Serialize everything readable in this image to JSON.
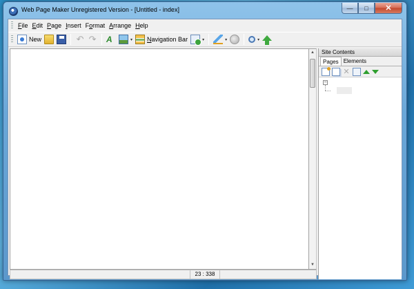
{
  "window": {
    "title": "Web Page Maker Unregistered Version - [Untitled - index]",
    "controls": {
      "minimize": "—",
      "maximize": "□",
      "close": "✕"
    }
  },
  "menubar": {
    "items": [
      {
        "label": "File",
        "accel": "F",
        "rest": "ile"
      },
      {
        "label": "Edit",
        "accel": "E",
        "rest": "dit"
      },
      {
        "label": "Page",
        "accel": "P",
        "rest": "age"
      },
      {
        "label": "Insert",
        "accel": "I",
        "rest": "nsert"
      },
      {
        "label": "Format",
        "pre": "F",
        "accel": "o",
        "rest": "rmat"
      },
      {
        "label": "Arrange",
        "accel": "A",
        "rest": "rrange"
      },
      {
        "label": "Help",
        "accel": "H",
        "rest": "elp"
      }
    ]
  },
  "toolbar": {
    "new_label": "New",
    "navbar_label": "Navigation Bar",
    "navbar_accel": "N",
    "navbar_rest": "avigation Bar",
    "icons": [
      "new-page-icon",
      "open-folder-icon",
      "save-disk-icon",
      "undo-icon",
      "redo-icon",
      "text-icon",
      "image-icon",
      "navigation-bar-icon",
      "form-icon",
      "pencil-icon",
      "publish-icon",
      "zoom-icon",
      "upload-icon"
    ],
    "drop_glyph": "▾"
  },
  "status": {
    "position": "23 : 338"
  },
  "panel": {
    "title": "Site Contents",
    "tabs": [
      "Pages",
      "Elements"
    ],
    "active_tab": "Pages",
    "tree_expander": "−"
  },
  "glyphs": {
    "undo": "↶",
    "redo": "↷",
    "delete": "✕",
    "text": "A",
    "scroll_up": "▲",
    "scroll_down": "▼"
  },
  "colors": {
    "title_bar": "#6aa7d8",
    "close_button": "#c2472d",
    "arrow_green": "#2f9f2f"
  }
}
